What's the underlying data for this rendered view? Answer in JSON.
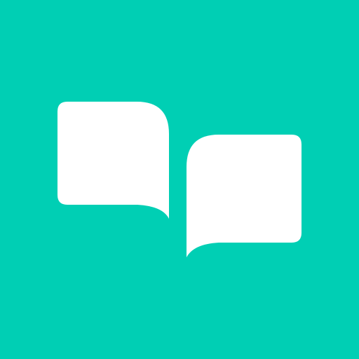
{
  "icon": {
    "name": "chat-bubbles-icon",
    "colors": {
      "background": "#00CFB4",
      "bubbles": "#FFFFFF"
    }
  }
}
